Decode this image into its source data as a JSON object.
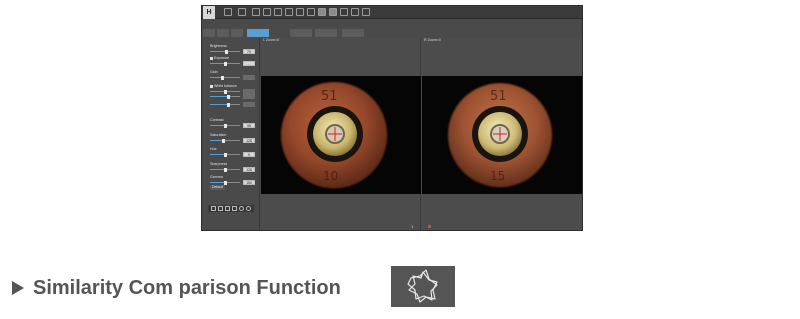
{
  "app": {
    "logo_text": "H",
    "toolbar_icons": [
      "new-icon",
      "open-icon",
      "cursor-icon",
      "hand-icon",
      "undo-icon",
      "redo-icon",
      "delete-icon",
      "compare-icon",
      "flag-icon",
      "measure-icon",
      "camera-icon",
      "grid-icon",
      "close-icon"
    ],
    "tabs": [
      "",
      "",
      "",
      "",
      "",
      "",
      ""
    ]
  },
  "left_panel": {
    "controls": [
      {
        "label": "Brightness",
        "value": "75",
        "level": 0.55
      },
      {
        "label": "Exposure",
        "value": "-",
        "level": 0.5,
        "checkbox": true
      },
      {
        "label": "Gain",
        "value": "",
        "level": 0.4
      },
      {
        "label": "White balance",
        "value": "",
        "level": 0.5,
        "checkbox": true
      },
      {
        "label": "",
        "value": "",
        "level": 0.6
      },
      {
        "label": "",
        "value": "",
        "level": 0.6
      },
      {
        "label": "Contrast",
        "value": "95",
        "level": 0.5
      },
      {
        "label": "Saturation",
        "value": "128",
        "level": 0.45
      },
      {
        "label": "Hue",
        "value": "0",
        "level": 0.5
      },
      {
        "label": "Sharpness",
        "value": "128",
        "level": 0.5
      },
      {
        "label": "Gamma",
        "value": "150",
        "level": 0.5
      }
    ],
    "default_label": "Default",
    "bottom_tool_icons": [
      "grid-tool-icon",
      "magnifier-tool-icon",
      "rotate-tool-icon",
      "list-tool-icon",
      "circle-tool-icon",
      "settings-tool-icon"
    ]
  },
  "views": {
    "left": {
      "zoom_label": "L Zoom=0"
    },
    "right": {
      "zoom_label": "R Zoom=0"
    },
    "page_number": "1"
  },
  "feature": {
    "title": "Similarity Com parison Function"
  },
  "colors": {
    "accent": "#5a9fd0",
    "panel": "#4a4a4a",
    "caption": "#555555"
  }
}
